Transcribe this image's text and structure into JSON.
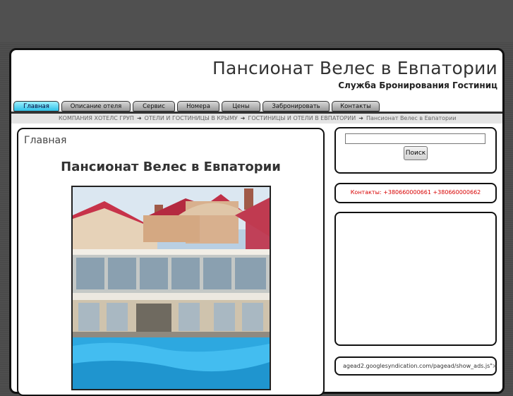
{
  "header": {
    "title": "Пансионат Велес в Евпатории",
    "subtitle": "Служба Бронирования Гостиниц"
  },
  "nav": {
    "items": [
      {
        "label": "Главная",
        "active": true
      },
      {
        "label": "Описание отеля"
      },
      {
        "label": "Сервис"
      },
      {
        "label": "Номера"
      },
      {
        "label": "Цены"
      },
      {
        "label": "Забронировать"
      },
      {
        "label": "Контакты"
      }
    ]
  },
  "breadcrumb": {
    "items": [
      "КОМПАНИЯ ХОТЕЛС ГРУП",
      "ОТЕЛИ И ГОСТИНИЦЫ В КРЫМУ",
      "ГОСТИНИЦЫ И ОТЕЛИ В ЕВПАТОРИИ",
      "Пансионат Велес в Евпатории"
    ],
    "separator": "➜"
  },
  "main": {
    "section_title": "Главная",
    "article_title": "Пансионат Велес в Евпатории"
  },
  "sidebar": {
    "search_button": "Поиск",
    "contacts": "Контакты: +380660000661 +380660000662",
    "ad_code": "agead2.googlesyndication.com/pagead/show_ads.js\">"
  },
  "colors": {
    "nav_active": "#2ec2e8",
    "contacts_text": "#d80000"
  }
}
